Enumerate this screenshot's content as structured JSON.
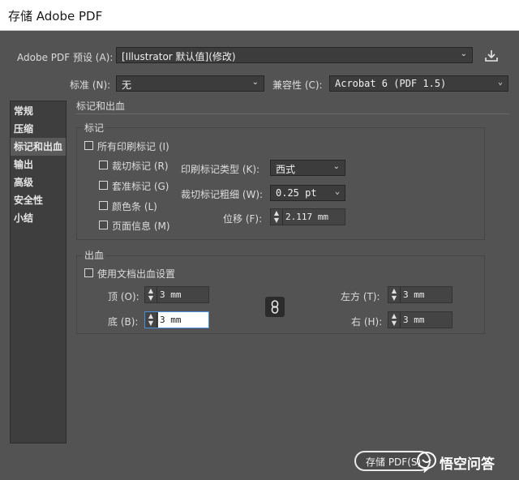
{
  "window": {
    "title": "存储 Adobe PDF"
  },
  "preset": {
    "label": "Adobe PDF 预设 (A):",
    "value": "[Illustrator 默认值](修改)"
  },
  "standard": {
    "label": "标准 (N):",
    "value": "无"
  },
  "compat": {
    "label": "兼容性 (C):",
    "value": "Acrobat 6 (PDF 1.5)"
  },
  "sidebar": {
    "items": [
      {
        "label": "常规"
      },
      {
        "label": "压缩"
      },
      {
        "label": "标记和出血",
        "active": true
      },
      {
        "label": "输出"
      },
      {
        "label": "高级"
      },
      {
        "label": "安全性"
      },
      {
        "label": "小结"
      }
    ]
  },
  "panel": {
    "title": "标记和出血"
  },
  "marks": {
    "title": "标记",
    "all_marks": "所有印刷标记 (I)",
    "trim_marks": "裁切标记 (R)",
    "registration_marks": "套准标记 (G)",
    "color_bars": "颜色条 (L)",
    "page_info": "页面信息 (M)",
    "type_label": "印刷标记类型 (K):",
    "type_value": "西式",
    "weight_label": "裁切标记粗细 (W):",
    "weight_value": "0.25 pt",
    "offset_label": "位移 (F):",
    "offset_value": "2.117 mm"
  },
  "bleed": {
    "title": "出血",
    "use_doc": "使用文档出血设置",
    "top_label": "顶 (O):",
    "top_value": "3 mm",
    "bottom_label": "底 (B):",
    "bottom_value": "3 mm",
    "left_label": "左方 (T):",
    "left_value": "3 mm",
    "right_label": "右 (H):",
    "right_value": "3 mm"
  },
  "footer": {
    "save_label": "存储 PDF(S)",
    "watermark": "悟空问答"
  }
}
